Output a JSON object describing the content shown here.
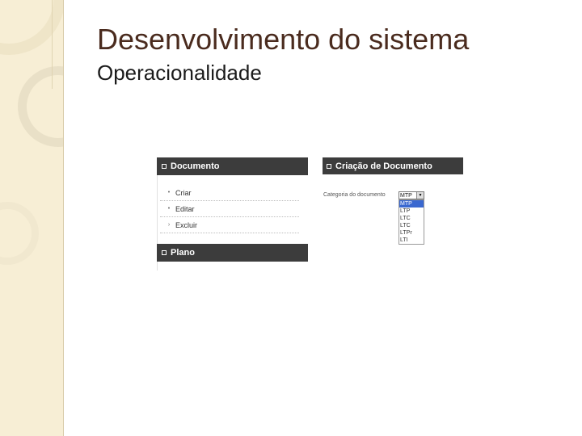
{
  "slide": {
    "title": "Desenvolvimento do sistema",
    "subtitle": "Operacionalidade"
  },
  "left_panel": {
    "document_header": "Documento",
    "menu_items": [
      {
        "label": "Criar"
      },
      {
        "label": "Editar"
      },
      {
        "label": "Excluir"
      }
    ],
    "plan_header": "Plano"
  },
  "right_panel": {
    "header": "Criação de Documento",
    "category_label": "Categoria do documento",
    "select": {
      "selected": "MTP",
      "options": [
        "MTP",
        "LTP",
        "LTC",
        "LTC",
        "LTPr",
        "LTI"
      ],
      "highlighted_index": 0
    }
  },
  "colors": {
    "sidebar": "#f7eed5",
    "header_bar": "#3c3c3c",
    "title_text": "#4a2b1e",
    "selection": "#3a68d0"
  }
}
